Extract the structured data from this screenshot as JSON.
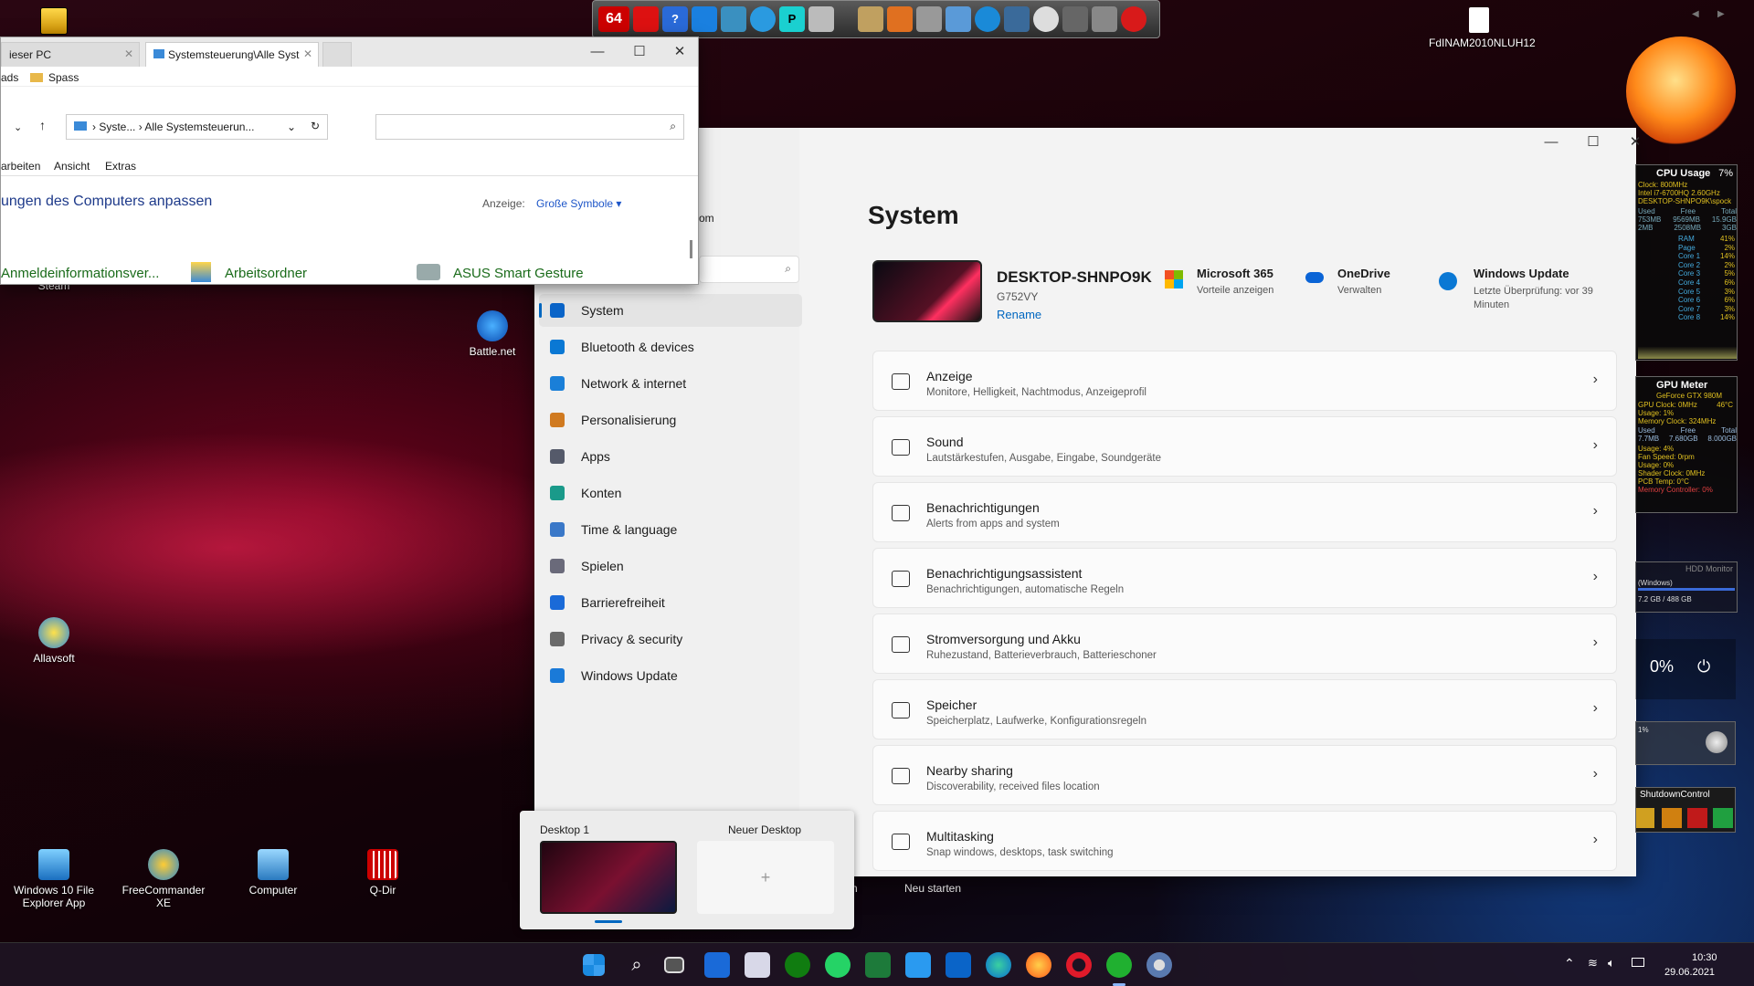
{
  "desktop": {
    "icons": [
      {
        "label": "Steam"
      },
      {
        "label": "Battle.net"
      },
      {
        "label": "Allavsoft"
      },
      {
        "label": "Windows 10 File Explorer App"
      },
      {
        "label": "FreeCommander XE"
      },
      {
        "label": "Computer"
      },
      {
        "label": "Q-Dir"
      },
      {
        "label": "FdINAM2010NLUH12"
      }
    ],
    "neu_starten": "Neu starten"
  },
  "launcher": {
    "badge": "64"
  },
  "explorer": {
    "tab1": "ieser PC",
    "tab2": "Systemsteuerung\\Alle Syst",
    "ribbon_left": "ads",
    "ribbon_folder": "Spass",
    "addr_1": "Syste...",
    "addr_2": "Alle Systemsteuerun...",
    "menu": [
      "arbeiten",
      "Ansicht",
      "Extras"
    ],
    "title": "ungen des Computers anpassen",
    "anzeige_label": "Anzeige:",
    "anzeige_value": "Große Symbole",
    "items": [
      "Anmeldeinformationsver...",
      "Arbeitsordner",
      "ASUS Smart Gesture"
    ]
  },
  "settings": {
    "partial": "om",
    "title": "System",
    "device": {
      "name": "DESKTOP-SHNPO9K",
      "model": "G752VY",
      "rename": "Rename"
    },
    "tiles": [
      {
        "title": "Microsoft 365",
        "sub": "Vorteile anzeigen",
        "color": "#f25022"
      },
      {
        "title": "OneDrive",
        "sub": "Verwalten",
        "color": "#0a64d6"
      },
      {
        "title": "Windows Update",
        "sub": "Letzte Überprüfung: vor 39 Minuten",
        "color": "#0a78d4"
      }
    ],
    "nav": [
      {
        "label": "System",
        "color": "#0a64c8"
      },
      {
        "label": "Bluetooth & devices",
        "color": "#0a78d4"
      },
      {
        "label": "Network & internet",
        "color": "#1a7fd8"
      },
      {
        "label": "Personalisierung",
        "color": "#d07a20"
      },
      {
        "label": "Apps",
        "color": "#555a6a"
      },
      {
        "label": "Konten",
        "color": "#1a9a8a"
      },
      {
        "label": "Time & language",
        "color": "#3a78c8"
      },
      {
        "label": "Spielen",
        "color": "#6a6a7a"
      },
      {
        "label": "Barrierefreiheit",
        "color": "#1a6ad8"
      },
      {
        "label": "Privacy & security",
        "color": "#6a6a6a"
      },
      {
        "label": "Windows Update",
        "color": "#1a7ad8"
      }
    ],
    "cards": [
      {
        "title": "Anzeige",
        "sub": "Monitore, Helligkeit, Nachtmodus, Anzeigeprofil"
      },
      {
        "title": "Sound",
        "sub": "Lautstärkestufen, Ausgabe, Eingabe, Soundgeräte"
      },
      {
        "title": "Benachrichtigungen",
        "sub": "Alerts from apps and system"
      },
      {
        "title": "Benachrichtigungsassistent",
        "sub": "Benachrichtigungen, automatische Regeln"
      },
      {
        "title": "Stromversorgung und Akku",
        "sub": "Ruhezustand, Batterieverbrauch, Batterieschoner"
      },
      {
        "title": "Speicher",
        "sub": "Speicherplatz, Laufwerke, Konfigurationsregeln"
      },
      {
        "title": "Nearby sharing",
        "sub": "Discoverability, received files location"
      },
      {
        "title": "Multitasking",
        "sub": "Snap windows, desktops, task switching"
      }
    ]
  },
  "taskview": {
    "desktop1": "Desktop 1",
    "new": "Neuer Desktop",
    "plus": "+"
  },
  "widgets": {
    "cpu_title": "CPU Usage",
    "cpu_pct": "7%",
    "cpu_lines": [
      "Clock: 800MHz",
      "Intel i7-6700HQ 2.60GHz",
      "DESKTOP-SHNPO9K\\spock"
    ],
    "cpu_cols": [
      "Used",
      "Free",
      "Total"
    ],
    "cpu_rows": [
      [
        "753MB",
        "9569MB",
        "15.9GB"
      ],
      [
        "2MB",
        "2508MB",
        "3GB"
      ]
    ],
    "cpu_cores": [
      [
        "RAM",
        "41%"
      ],
      [
        "Page",
        "2%"
      ],
      [
        "Core 1",
        "14%"
      ],
      [
        "Core 2",
        "2%"
      ],
      [
        "Core 3",
        "5%"
      ],
      [
        "Core 4",
        "6%"
      ],
      [
        "Core 5",
        "3%"
      ],
      [
        "Core 6",
        "6%"
      ],
      [
        "Core 7",
        "3%"
      ],
      [
        "Core 8",
        "14%"
      ]
    ],
    "gpu_title": "GPU Meter",
    "gpu_name": "GeForce GTX 980M",
    "gpu_temp": "46°C",
    "gpu_lines": [
      "GPU Clock: 0MHz",
      "Usage: 1%",
      "Memory Clock: 324MHz"
    ],
    "gpu_cols": [
      "Used",
      "Free",
      "Total"
    ],
    "gpu_row": [
      "7.7MB",
      "7.680GB",
      "8.000GB"
    ],
    "gpu_lines2": [
      "Usage: 4%",
      "Fan Speed: 0rpm",
      "Usage: 0%",
      "Shader Clock: 0MHz",
      "PCB Temp: 0°C",
      "Memory Controller: 0%"
    ],
    "hdd_title": "HDD Monitor",
    "hdd_drive": "(Windows)",
    "hdd_size": "7.2 GB / 488 GB",
    "battery_pct": "0%",
    "vol_pct": "1%",
    "shutdown": "ShutdownControl"
  },
  "taskbar": {
    "time": "10:30",
    "date": "29.06.2021"
  },
  "colors": {
    "accent": "#0067c0"
  }
}
